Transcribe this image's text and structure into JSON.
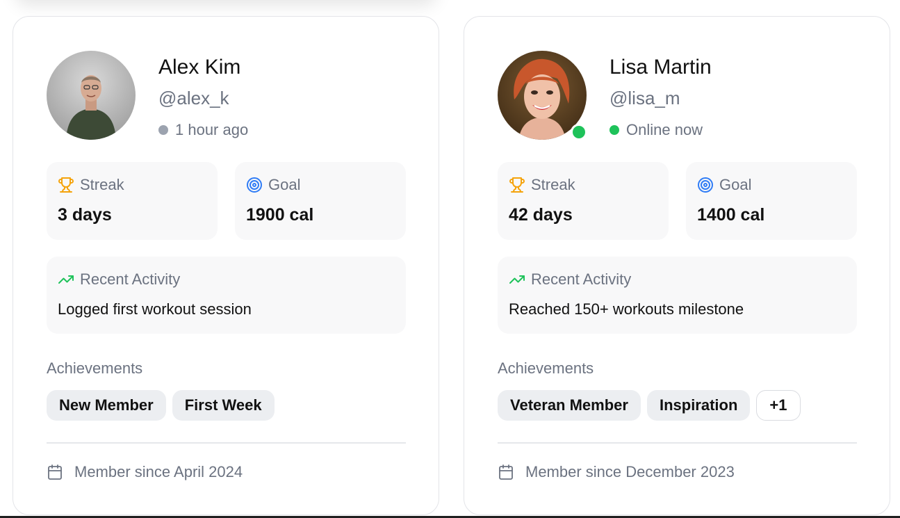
{
  "colors": {
    "online": "#1ec25a",
    "offline": "#9ca3af",
    "trophy": "#f5a30b",
    "target": "#2f7cf6",
    "trend": "#1ec25a",
    "muted_text": "#6b7280"
  },
  "labels": {
    "streak": "Streak",
    "goal": "Goal",
    "recent_activity": "Recent Activity",
    "achievements": "Achievements"
  },
  "users": [
    {
      "name": "Alex Kim",
      "handle": "@alex_k",
      "status": "1 hour ago",
      "online": false,
      "avatar_icon": "avatar-photo-man",
      "streak": "3 days",
      "goal": "1900 cal",
      "activity": "Logged first workout session",
      "badges": [
        "New Member",
        "First Week"
      ],
      "more_badges": "",
      "member_since": "Member since April 2024"
    },
    {
      "name": "Lisa Martin",
      "handle": "@lisa_m",
      "status": "Online now",
      "online": true,
      "avatar_icon": "avatar-photo-woman",
      "streak": "42 days",
      "goal": "1400 cal",
      "activity": "Reached 150+ workouts milestone",
      "badges": [
        "Veteran Member",
        "Inspiration"
      ],
      "more_badges": "+1",
      "member_since": "Member since December 2023"
    }
  ]
}
